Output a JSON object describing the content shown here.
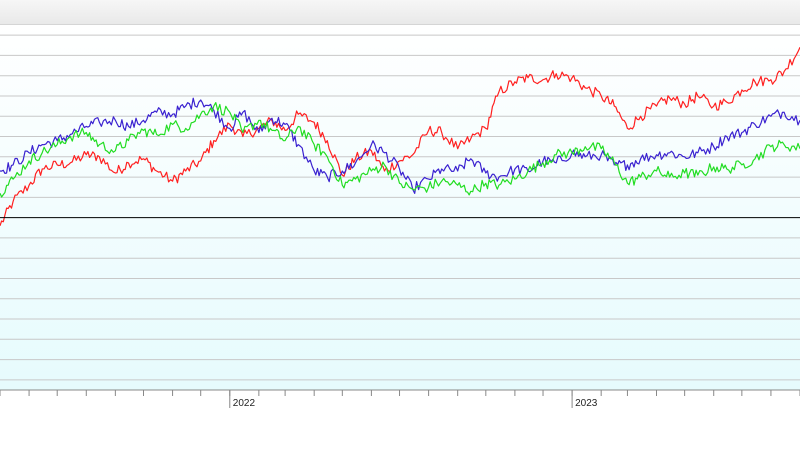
{
  "colors": {
    "background": "#ffffff",
    "plot_top": "#ffffff",
    "plot_bottom": "#e6fbfd",
    "gridline": "#c8c8c8",
    "baseline": "#000000",
    "axis": "#888888",
    "red": "#ff2020",
    "blue": "#3a22d0",
    "green": "#22dd22"
  },
  "chart_data": {
    "type": "line",
    "title": "",
    "xlabel": "",
    "ylabel": "",
    "x_tick_labels": [
      "2022",
      "2023"
    ],
    "x_range": [
      "2021-05",
      "2023-12"
    ],
    "ylim": [
      -8.5,
      9.5
    ],
    "baseline_value": 0,
    "grid": true,
    "legend": "none",
    "series": [
      {
        "color": "#ff2020",
        "points": [
          [
            "2021-05-01",
            -0.4
          ],
          [
            "2021-05-15",
            0.8
          ],
          [
            "2021-06-01",
            1.6
          ],
          [
            "2021-06-15",
            2.4
          ],
          [
            "2021-07-01",
            2.6
          ],
          [
            "2021-07-15",
            2.7
          ],
          [
            "2021-08-01",
            3.1
          ],
          [
            "2021-08-15",
            3.0
          ],
          [
            "2021-09-01",
            2.2
          ],
          [
            "2021-09-15",
            2.7
          ],
          [
            "2021-10-01",
            2.9
          ],
          [
            "2021-10-15",
            2.3
          ],
          [
            "2021-11-01",
            1.8
          ],
          [
            "2021-11-15",
            2.3
          ],
          [
            "2021-12-01",
            2.8
          ],
          [
            "2021-12-15",
            3.8
          ],
          [
            "2022-01-01",
            4.6
          ],
          [
            "2022-01-15",
            4.0
          ],
          [
            "2022-02-01",
            4.4
          ],
          [
            "2022-02-15",
            4.8
          ],
          [
            "2022-03-01",
            4.3
          ],
          [
            "2022-03-15",
            5.1
          ],
          [
            "2022-04-01",
            4.7
          ],
          [
            "2022-04-15",
            3.8
          ],
          [
            "2022-05-01",
            2.1
          ],
          [
            "2022-05-15",
            2.9
          ],
          [
            "2022-06-01",
            3.3
          ],
          [
            "2022-06-15",
            2.3
          ],
          [
            "2022-07-01",
            2.8
          ],
          [
            "2022-07-15",
            3.1
          ],
          [
            "2022-08-01",
            4.3
          ],
          [
            "2022-08-15",
            4.2
          ],
          [
            "2022-09-01",
            3.4
          ],
          [
            "2022-09-15",
            3.9
          ],
          [
            "2022-10-01",
            4.4
          ],
          [
            "2022-10-15",
            6.2
          ],
          [
            "2022-11-01",
            6.7
          ],
          [
            "2022-11-15",
            6.9
          ],
          [
            "2022-12-01",
            6.8
          ],
          [
            "2022-12-15",
            7.1
          ],
          [
            "2023-01-01",
            6.9
          ],
          [
            "2023-01-15",
            6.4
          ],
          [
            "2023-02-01",
            6.0
          ],
          [
            "2023-02-15",
            5.5
          ],
          [
            "2023-03-01",
            4.4
          ],
          [
            "2023-03-15",
            5.0
          ],
          [
            "2023-04-01",
            5.5
          ],
          [
            "2023-04-15",
            5.9
          ],
          [
            "2023-05-01",
            5.6
          ],
          [
            "2023-05-15",
            6.0
          ],
          [
            "2023-06-01",
            5.5
          ],
          [
            "2023-06-15",
            5.7
          ],
          [
            "2023-07-01",
            6.3
          ],
          [
            "2023-07-15",
            6.7
          ],
          [
            "2023-08-01",
            6.8
          ],
          [
            "2023-08-15",
            7.2
          ],
          [
            "2023-09-01",
            8.4
          ]
        ]
      },
      {
        "color": "#3a22d0",
        "points": [
          [
            "2021-05-01",
            2.3
          ],
          [
            "2021-05-15",
            2.6
          ],
          [
            "2021-06-01",
            3.2
          ],
          [
            "2021-06-15",
            3.6
          ],
          [
            "2021-07-01",
            3.8
          ],
          [
            "2021-07-15",
            4.1
          ],
          [
            "2021-08-01",
            4.5
          ],
          [
            "2021-08-15",
            4.7
          ],
          [
            "2021-09-01",
            4.8
          ],
          [
            "2021-09-15",
            4.5
          ],
          [
            "2021-10-01",
            4.8
          ],
          [
            "2021-10-15",
            5.2
          ],
          [
            "2021-11-01",
            5.1
          ],
          [
            "2021-11-15",
            5.5
          ],
          [
            "2021-12-01",
            5.8
          ],
          [
            "2021-12-15",
            5.3
          ],
          [
            "2022-01-01",
            4.4
          ],
          [
            "2022-01-15",
            5.2
          ],
          [
            "2022-02-01",
            4.2
          ],
          [
            "2022-02-15",
            4.9
          ],
          [
            "2022-03-01",
            4.6
          ],
          [
            "2022-03-15",
            3.6
          ],
          [
            "2022-04-01",
            2.3
          ],
          [
            "2022-04-15",
            2.0
          ],
          [
            "2022-05-01",
            2.3
          ],
          [
            "2022-05-15",
            2.7
          ],
          [
            "2022-06-01",
            3.6
          ],
          [
            "2022-06-15",
            3.2
          ],
          [
            "2022-07-01",
            2.4
          ],
          [
            "2022-07-15",
            1.4
          ],
          [
            "2022-08-01",
            1.9
          ],
          [
            "2022-08-15",
            2.4
          ],
          [
            "2022-09-01",
            2.3
          ],
          [
            "2022-09-15",
            2.9
          ],
          [
            "2022-10-01",
            2.2
          ],
          [
            "2022-10-15",
            2.0
          ],
          [
            "2022-11-01",
            2.4
          ],
          [
            "2022-11-15",
            2.3
          ],
          [
            "2022-12-01",
            2.8
          ],
          [
            "2022-12-15",
            2.7
          ],
          [
            "2023-01-01",
            3.2
          ],
          [
            "2023-01-15",
            3.0
          ],
          [
            "2023-02-01",
            3.1
          ],
          [
            "2023-02-15",
            2.6
          ],
          [
            "2023-03-01",
            2.6
          ],
          [
            "2023-03-15",
            2.9
          ],
          [
            "2023-04-01",
            3.1
          ],
          [
            "2023-04-15",
            3.2
          ],
          [
            "2023-05-01",
            3.0
          ],
          [
            "2023-05-15",
            3.2
          ],
          [
            "2023-06-01",
            3.5
          ],
          [
            "2023-06-15",
            4.0
          ],
          [
            "2023-07-01",
            4.2
          ],
          [
            "2023-07-15",
            4.6
          ],
          [
            "2023-08-01",
            5.0
          ],
          [
            "2023-08-15",
            5.2
          ],
          [
            "2023-09-01",
            4.8
          ]
        ]
      },
      {
        "color": "#22dd22",
        "points": [
          [
            "2021-05-01",
            1.2
          ],
          [
            "2021-05-15",
            1.9
          ],
          [
            "2021-06-01",
            2.8
          ],
          [
            "2021-06-15",
            3.2
          ],
          [
            "2021-07-01",
            3.6
          ],
          [
            "2021-07-15",
            4.0
          ],
          [
            "2021-08-01",
            4.2
          ],
          [
            "2021-08-15",
            3.6
          ],
          [
            "2021-09-01",
            3.3
          ],
          [
            "2021-09-15",
            3.8
          ],
          [
            "2021-10-01",
            4.3
          ],
          [
            "2021-10-15",
            4.1
          ],
          [
            "2021-11-01",
            4.6
          ],
          [
            "2021-11-15",
            4.4
          ],
          [
            "2021-12-01",
            5.1
          ],
          [
            "2021-12-15",
            5.5
          ],
          [
            "2022-01-01",
            5.2
          ],
          [
            "2022-01-15",
            4.2
          ],
          [
            "2022-02-01",
            4.8
          ],
          [
            "2022-02-15",
            4.3
          ],
          [
            "2022-03-01",
            3.8
          ],
          [
            "2022-03-15",
            4.5
          ],
          [
            "2022-04-01",
            3.6
          ],
          [
            "2022-04-15",
            3.0
          ],
          [
            "2022-05-01",
            1.6
          ],
          [
            "2022-05-15",
            1.9
          ],
          [
            "2022-06-01",
            2.3
          ],
          [
            "2022-06-15",
            2.6
          ],
          [
            "2022-07-01",
            1.7
          ],
          [
            "2022-07-15",
            1.4
          ],
          [
            "2022-08-01",
            1.5
          ],
          [
            "2022-08-15",
            1.8
          ],
          [
            "2022-09-01",
            1.6
          ],
          [
            "2022-09-15",
            1.3
          ],
          [
            "2022-10-01",
            1.7
          ],
          [
            "2022-10-15",
            1.6
          ],
          [
            "2022-11-01",
            1.9
          ],
          [
            "2022-11-15",
            2.3
          ],
          [
            "2022-12-01",
            2.7
          ],
          [
            "2022-12-15",
            3.1
          ],
          [
            "2023-01-01",
            3.2
          ],
          [
            "2023-01-15",
            3.5
          ],
          [
            "2023-02-01",
            3.4
          ],
          [
            "2023-02-15",
            2.7
          ],
          [
            "2023-03-01",
            1.7
          ],
          [
            "2023-03-15",
            2.0
          ],
          [
            "2023-04-01",
            2.3
          ],
          [
            "2023-04-15",
            2.0
          ],
          [
            "2023-05-01",
            2.2
          ],
          [
            "2023-05-15",
            2.1
          ],
          [
            "2023-06-01",
            2.5
          ],
          [
            "2023-06-15",
            2.4
          ],
          [
            "2023-07-01",
            2.6
          ],
          [
            "2023-07-15",
            2.9
          ],
          [
            "2023-08-01",
            3.5
          ],
          [
            "2023-08-15",
            3.6
          ],
          [
            "2023-09-01",
            3.4
          ]
        ]
      }
    ]
  }
}
